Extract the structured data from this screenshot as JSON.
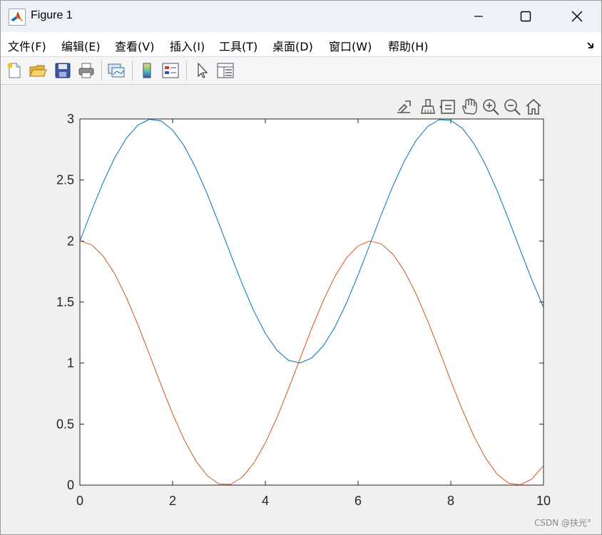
{
  "window": {
    "title": "Figure 1",
    "controls": [
      "minimize",
      "maximize",
      "close"
    ]
  },
  "menubar": {
    "items": [
      "文件(F)",
      "编辑(E)",
      "查看(V)",
      "插入(I)",
      "工具(T)",
      "桌面(D)",
      "窗口(W)",
      "帮助(H)"
    ]
  },
  "toolbar": {
    "icons": [
      "new-figure-icon",
      "open-file-icon",
      "save-icon",
      "print-icon",
      "link-plot-icon",
      "colorbar-icon",
      "legend-icon",
      "edit-plot-arrow-icon",
      "property-inspector-icon"
    ]
  },
  "axes_toolbar": {
    "icons": [
      "export-icon",
      "brush-icon",
      "data-tips-icon",
      "pan-hand-icon",
      "zoom-in-icon",
      "zoom-out-icon",
      "home-restore-icon"
    ]
  },
  "chart_data": {
    "type": "line",
    "title": "",
    "xlabel": "",
    "ylabel": "",
    "xlim": [
      0,
      10
    ],
    "ylim": [
      0,
      3
    ],
    "xticks": [
      "0",
      "2",
      "4",
      "6",
      "8",
      "10"
    ],
    "yticks": [
      "0",
      "0.5",
      "1",
      "1.5",
      "2",
      "2.5",
      "3"
    ],
    "grid": false,
    "series": [
      {
        "color": "#0072bd",
        "x": [
          0,
          0.25,
          0.5,
          0.75,
          1,
          1.25,
          1.5,
          1.75,
          2,
          2.25,
          2.5,
          2.75,
          3,
          3.25,
          3.5,
          3.75,
          4,
          4.25,
          4.5,
          4.75,
          5,
          5.25,
          5.5,
          5.75,
          6,
          6.25,
          6.5,
          6.75,
          7,
          7.25,
          7.5,
          7.75,
          8,
          8.25,
          8.5,
          8.75,
          9,
          9.25,
          9.5,
          9.75,
          10
        ],
        "y": [
          2,
          2.247,
          2.479,
          2.682,
          2.841,
          2.949,
          2.997,
          2.984,
          2.909,
          2.778,
          2.598,
          2.382,
          2.141,
          1.892,
          1.649,
          1.428,
          1.243,
          1.105,
          1.022,
          1.001,
          1.041,
          1.141,
          1.294,
          1.491,
          1.721,
          1.967,
          2.215,
          2.45,
          2.657,
          2.823,
          2.938,
          2.994,
          2.989,
          2.923,
          2.798,
          2.624,
          2.412,
          2.173,
          1.925,
          1.68,
          1.456
        ]
      },
      {
        "color": "#d95319",
        "x": [
          0,
          0.25,
          0.5,
          0.75,
          1,
          1.25,
          1.5,
          1.75,
          2,
          2.25,
          2.5,
          2.75,
          3,
          3.25,
          3.5,
          3.75,
          4,
          4.25,
          4.5,
          4.75,
          5,
          5.25,
          5.5,
          5.75,
          6,
          6.25,
          6.5,
          6.75,
          7,
          7.25,
          7.5,
          7.75,
          8,
          8.25,
          8.5,
          8.75,
          9,
          9.25,
          9.5,
          9.75,
          10
        ],
        "y": [
          2,
          1.969,
          1.878,
          1.732,
          1.54,
          1.315,
          1.071,
          0.822,
          0.584,
          0.372,
          0.199,
          0.076,
          0.01,
          0.006,
          0.064,
          0.18,
          0.346,
          0.554,
          0.789,
          1.037,
          1.284,
          1.512,
          1.709,
          1.861,
          1.96,
          2,
          1.977,
          1.893,
          1.754,
          1.567,
          1.347,
          1.104,
          0.855,
          0.615,
          0.4,
          0.221,
          0.089,
          0.015,
          0.003,
          0.051,
          0.161
        ]
      }
    ]
  },
  "watermark": "CSDN @扶光°"
}
